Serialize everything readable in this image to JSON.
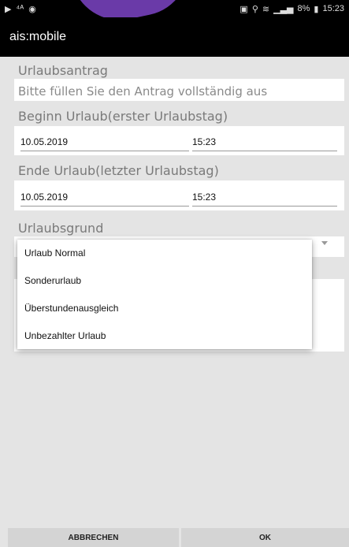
{
  "status_bar": {
    "icons_left": [
      "play-icon",
      "signal-icon",
      "sync-icon"
    ],
    "icons_right": [
      "cast-icon",
      "location-icon",
      "wifi-icon",
      "signal-bars-icon"
    ],
    "battery": "8%",
    "time": "15:23"
  },
  "app": {
    "title": "ais:mobile"
  },
  "form": {
    "request_label": "Urlaubsantrag",
    "request_hint": "Bitte füllen Sie den Antrag vollständig aus",
    "start_label": "Beginn Urlaub(erster Urlaubstag)",
    "start_date": "10.05.2019",
    "start_time": "15:23",
    "end_label": "Ende Urlaub(letzter Urlaubstag)",
    "end_date": "10.05.2019",
    "end_time": "15:23",
    "reason_label": "Urlaubsgrund"
  },
  "dropdown": {
    "options": [
      "Urlaub Normal",
      "Sonderurlaub",
      "Überstundenausgleich",
      "Unbezahlter Urlaub"
    ]
  },
  "buttons": {
    "cancel": "ABBRECHEN",
    "ok": "OK"
  },
  "colors": {
    "app_bar": "#000000",
    "background": "#e4e4e4",
    "card": "#ffffff",
    "accent_blob": "#6a3aa8"
  }
}
